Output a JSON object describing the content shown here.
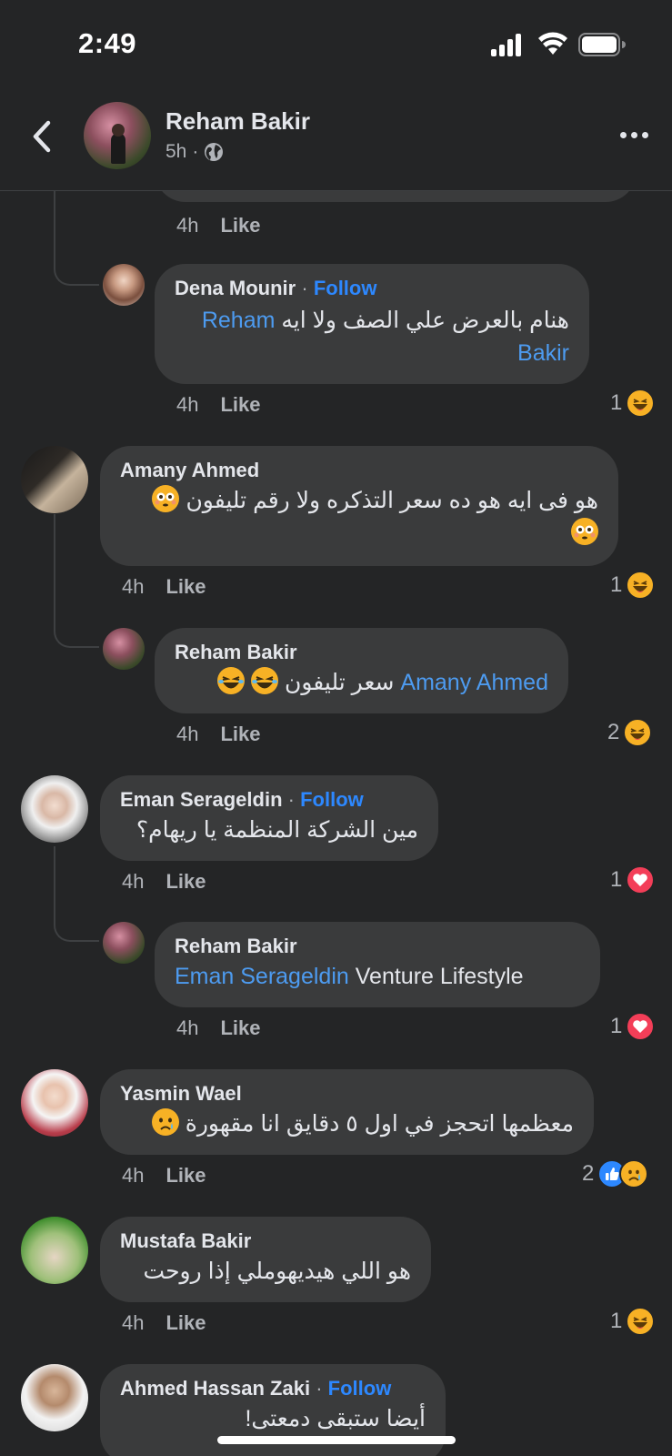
{
  "status_bar": {
    "time": "2:49"
  },
  "header": {
    "name": "Reham Bakir",
    "time": "5h",
    "privacy_separator": "·"
  },
  "comments": [
    {
      "time": "4h",
      "like_label": "Like"
    },
    {
      "name": "Dena Mounir",
      "sep": "·",
      "follow": "Follow",
      "text_rtl": "هنام بالعرض علي الصف ولا ايه",
      "mention_1": "Reham",
      "mention_2": "Bakir",
      "time": "4h",
      "like_label": "Like",
      "reaction_count": "1",
      "reaction": "haha"
    },
    {
      "name": "Amany Ahmed",
      "text_rtl": "هو فى ايه هو ده سعر التذكره ولا رقم تليفون",
      "time": "4h",
      "like_label": "Like",
      "reaction_count": "1",
      "reaction": "haha"
    },
    {
      "name": "Reham Bakir",
      "mention": "Amany Ahmed",
      "text_rtl": "سعر تليفون",
      "time": "4h",
      "like_label": "Like",
      "reaction_count": "2",
      "reaction": "haha"
    },
    {
      "name": "Eman Serageldin",
      "sep": "·",
      "follow": "Follow",
      "text_rtl": "مين الشركة المنظمة يا ريهام؟",
      "time": "4h",
      "like_label": "Like",
      "reaction_count": "1",
      "reaction": "love"
    },
    {
      "name": "Reham Bakir",
      "mention": "Eman Serageldin",
      "text": "Venture Lifestyle",
      "time": "4h",
      "like_label": "Like",
      "reaction_count": "1",
      "reaction": "love"
    },
    {
      "name": "Yasmin Wael",
      "text_rtl": "معظمها اتحجز في اول ٥ دقايق انا مقهورة",
      "time": "4h",
      "like_label": "Like",
      "reaction_count": "2",
      "reaction": "like+sad"
    },
    {
      "name": "Mustafa Bakir",
      "text_rtl": "هو اللي هيديهوملي إذا روحت",
      "time": "4h",
      "like_label": "Like",
      "reaction_count": "1",
      "reaction": "haha"
    },
    {
      "name": "Ahmed Hassan Zaki",
      "sep": "·",
      "follow": "Follow",
      "text_rtl": "أيضا ستبقى دمعتى!"
    }
  ],
  "colors": {
    "background": "#242526",
    "bubble": "#3a3b3c",
    "link": "#2d88ff",
    "mention": "#4d9bf0",
    "meta": "#b0b3b8"
  },
  "icons": [
    "back-chevron-icon",
    "globe-icon",
    "more-icon",
    "haha-reaction-icon",
    "love-reaction-icon",
    "like-reaction-icon",
    "sad-reaction-icon",
    "flushed-emoji-icon",
    "laughing-emoji-icon",
    "sad-emoji-icon"
  ]
}
